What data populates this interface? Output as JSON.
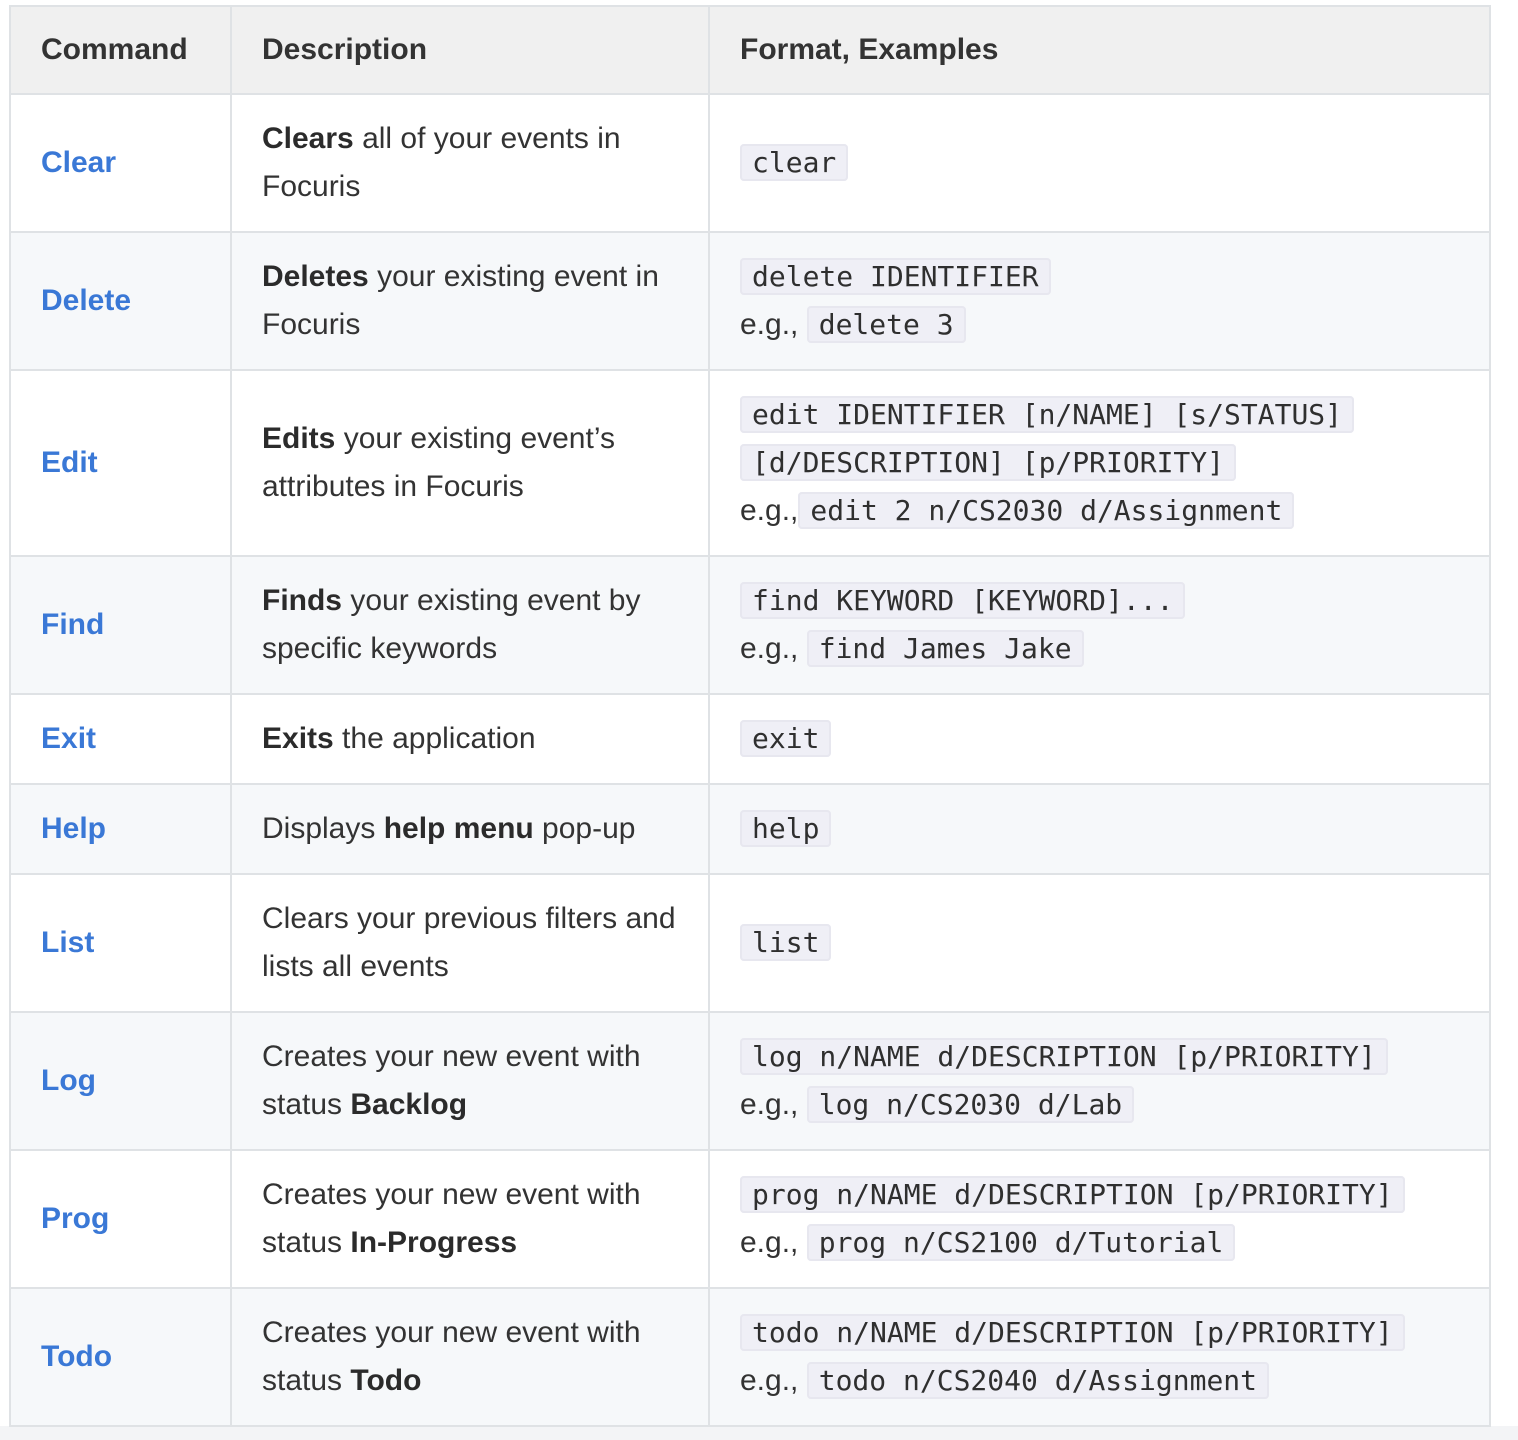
{
  "table": {
    "headers": [
      "Command",
      "Description",
      "Format, Examples"
    ],
    "rows": [
      {
        "command": "Clear",
        "desc_bold": "Clears",
        "desc_rest": " all of your events in Focuris",
        "format": "clear"
      },
      {
        "command": "Delete",
        "desc_bold": "Deletes",
        "desc_rest": " your existing event in Focuris",
        "format": "delete IDENTIFIER",
        "eg_label": "e.g.,",
        "example": "delete 3"
      },
      {
        "command": "Edit",
        "desc_bold": "Edits",
        "desc_rest": " your existing event’s attributes in Focuris",
        "format": "edit IDENTIFIER [n/NAME] [s/STATUS]",
        "format_cont": "[d/DESCRIPTION] [p/PRIORITY]",
        "eg_label": "e.g.,",
        "example": "edit 2 n/CS2030 d/Assignment"
      },
      {
        "command": "Find",
        "desc_bold": "Finds",
        "desc_rest": " your existing event by specific keywords",
        "format": "find KEYWORD [KEYWORD]...",
        "eg_label": "e.g.,",
        "example": "find James Jake"
      },
      {
        "command": "Exit",
        "desc_bold": "Exits",
        "desc_rest": " the application",
        "format": "exit"
      },
      {
        "command": "Help",
        "desc_pre": "Displays ",
        "desc_bold": "help menu",
        "desc_rest": " pop-up",
        "format": "help"
      },
      {
        "command": "List",
        "desc_pre": "Clears your previous filters and lists all events",
        "format": "list"
      },
      {
        "command": "Log",
        "desc_pre": "Creates your new event with status ",
        "desc_bold": "Backlog",
        "format": "log n/NAME d/DESCRIPTION [p/PRIORITY]",
        "eg_label": "e.g.,",
        "example": "log n/CS2030 d/Lab"
      },
      {
        "command": "Prog",
        "desc_pre": "Creates your new event with status ",
        "desc_bold": "In-Progress",
        "format": "prog n/NAME d/DESCRIPTION [p/PRIORITY]",
        "eg_label": "e.g.,",
        "example": "prog n/CS2100 d/Tutorial"
      },
      {
        "command": "Todo",
        "desc_pre": "Creates your new event with status ",
        "desc_bold": "Todo",
        "format": "todo n/NAME d/DESCRIPTION [p/PRIORITY]",
        "eg_label": "e.g.,",
        "example": "todo n/CS2040 d/Assignment"
      }
    ]
  },
  "colors": {
    "command_link": "#3a78d6",
    "header_bg": "#f0f0f0",
    "stripe_bg": "#f6f8fa",
    "border": "#dfe2e5",
    "code_bg": "#efeff6"
  }
}
